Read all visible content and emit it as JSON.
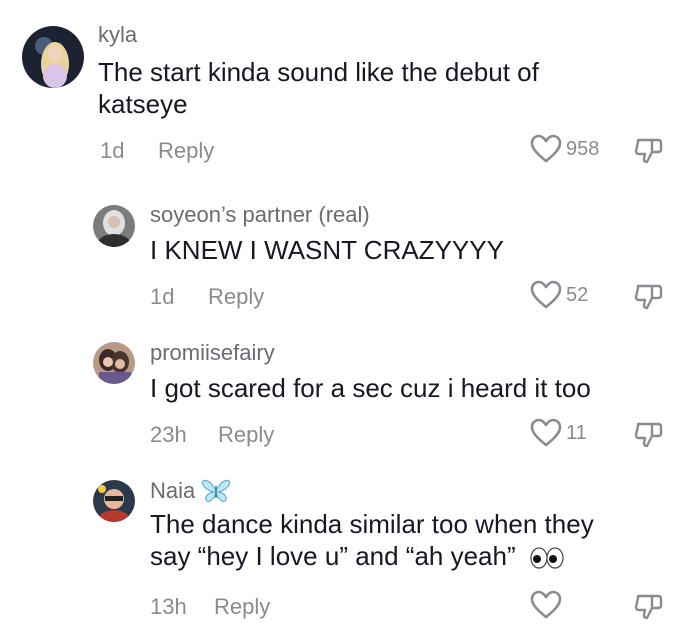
{
  "comments": [
    {
      "username": "kyla",
      "text_line1": "The start kinda sound like the debut of",
      "text_line2": "katseye",
      "time": "1d",
      "reply_label": "Reply",
      "likes": "958"
    },
    {
      "username": "soyeon’s partner (real)",
      "text": "I KNEW I WASNT CRAZYYYY",
      "time": "1d",
      "reply_label": "Reply",
      "likes": "52"
    },
    {
      "username": "promiisefairy",
      "text": "I got scared for a sec cuz i heard it too",
      "time": "23h",
      "reply_label": "Reply",
      "likes": "11"
    },
    {
      "username": "Naia",
      "username_emoji": "butterfly-icon",
      "text_line1": "The dance kinda similar too when they",
      "text_line2": "say “hey I love u” and “ah yeah”",
      "text_emoji": "eyes-icon",
      "time": "13h",
      "reply_label": "Reply",
      "likes": ""
    }
  ],
  "colors": {
    "text": "#161823",
    "muted": "#8a8b91",
    "butterfly": "#7ec8e3"
  }
}
